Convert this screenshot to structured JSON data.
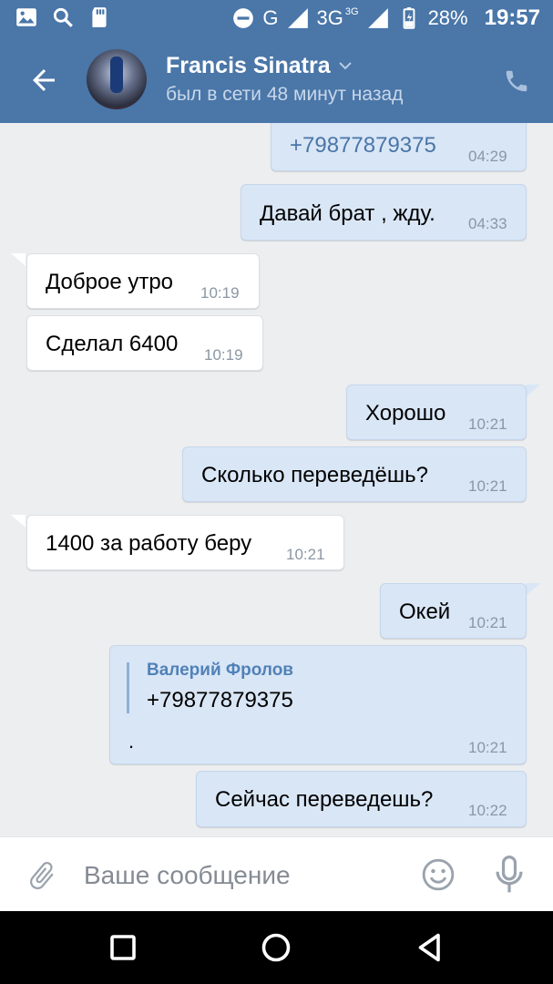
{
  "status_bar": {
    "network_g": "G",
    "network_3g": "3G",
    "network_3g_sup": "3G",
    "battery": "28%",
    "time": "19:57"
  },
  "header": {
    "name": "Francis Sinatra",
    "status": "был в сети 48 минут назад"
  },
  "messages": [
    {
      "dir": "out",
      "text": "+79877879375",
      "time": "04:29"
    },
    {
      "dir": "out",
      "text": "Давай брат , жду.",
      "time": "04:33"
    },
    {
      "dir": "in",
      "text": "Доброе утро",
      "time": "10:19"
    },
    {
      "dir": "in",
      "text": "Сделал 6400",
      "time": "10:19"
    },
    {
      "dir": "out",
      "text": "Хорошо",
      "time": "10:21"
    },
    {
      "dir": "out",
      "text": "Сколько переведёшь?",
      "time": "10:21"
    },
    {
      "dir": "in",
      "text": "1400 за работу беру",
      "time": "10:21"
    },
    {
      "dir": "out",
      "text": "Окей",
      "time": "10:21"
    },
    {
      "dir": "out",
      "forward_author": "Валерий Фролов",
      "forward_text": "+79877879375",
      "text": ".",
      "time": "10:21"
    },
    {
      "dir": "out",
      "text": "Сейчас переведешь?",
      "time": "10:22"
    }
  ],
  "input": {
    "placeholder": "Ваше сообщение"
  },
  "colors": {
    "accent": "#4a76a8",
    "bubble_out": "#d9e6f6",
    "bubble_in": "#ffffff",
    "background": "#edeef0"
  }
}
